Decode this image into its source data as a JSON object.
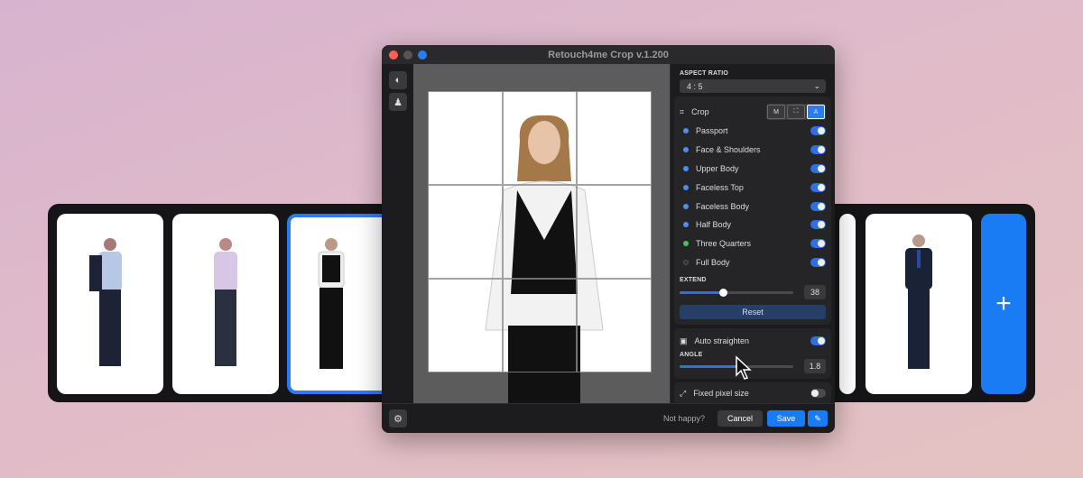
{
  "window": {
    "title": "Retouch4me Crop  v.1.200"
  },
  "panel": {
    "aspect_ratio_label": "ASPECT RATIO",
    "aspect_ratio_value": "4 : 5",
    "crop_label": "Crop",
    "crop_modes": [
      "M",
      "⛶",
      "A"
    ],
    "presets": [
      {
        "label": "Passport",
        "color": "#4a8ff0",
        "on": true
      },
      {
        "label": "Face & Shoulders",
        "color": "#4a8ff0",
        "on": true
      },
      {
        "label": "Upper Body",
        "color": "#4a8ff0",
        "on": true
      },
      {
        "label": "Faceless Top",
        "color": "#4a8ff0",
        "on": true
      },
      {
        "label": "Faceless Body",
        "color": "#4a8ff0",
        "on": true
      },
      {
        "label": "Half Body",
        "color": "#4a8ff0",
        "on": true
      },
      {
        "label": "Three Quarters",
        "color": "#4cc05a",
        "on": true
      },
      {
        "label": "Full Body",
        "color": "#333",
        "on": true
      }
    ],
    "extend_label": "EXTEND",
    "extend_value": "38",
    "extend_fraction": 0.38,
    "reset_label": "Reset",
    "auto_straighten_label": "Auto straighten",
    "auto_straighten_on": true,
    "angle_label": "ANGLE",
    "angle_value": "1.8",
    "angle_fraction": 0.52,
    "fixed_pixel_label": "Fixed pixel size",
    "fixed_pixel_on": false
  },
  "footer": {
    "not_happy": "Not happy?",
    "cancel": "Cancel",
    "save": "Save"
  },
  "strip": {
    "add_label": "+"
  }
}
